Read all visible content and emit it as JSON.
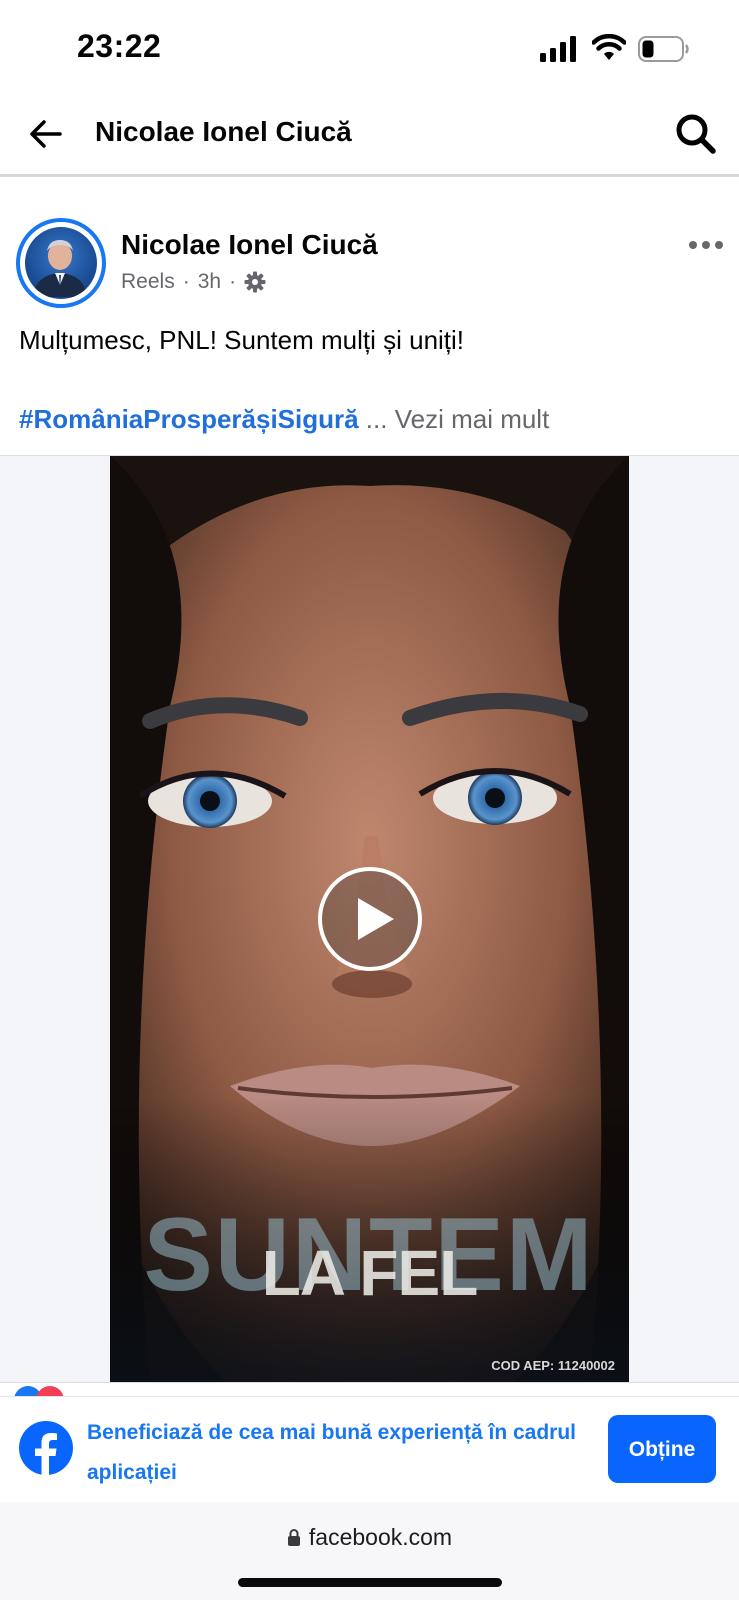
{
  "status_bar": {
    "time": "23:22",
    "battery_level": 0.25
  },
  "header": {
    "title": "Nicolae Ionel Ciucă"
  },
  "post": {
    "author": "Nicolae Ionel Ciucă",
    "category": "Reels",
    "separator": "·",
    "time_ago": "3h",
    "text": "Mulțumesc, PNL! Suntem mulți și uniți!",
    "hashtag": "#RomâniaProsperășiSigură",
    "ellipsis": " ... ",
    "see_more": "Vezi mai mult"
  },
  "video": {
    "overlay_big": "SUNTEM",
    "overlay_small": "LA FEL",
    "cod_aep": "COD AEP: 11240002"
  },
  "app_banner": {
    "text": "Beneficiază de cea mai bună experiență în cadrul aplicației",
    "button_label": "Obține"
  },
  "browser": {
    "url": "facebook.com"
  },
  "colors": {
    "accent": "#1877f2",
    "button": "#0866ff",
    "hashtag": "#216fdb",
    "secondary_text": "#65676b"
  }
}
